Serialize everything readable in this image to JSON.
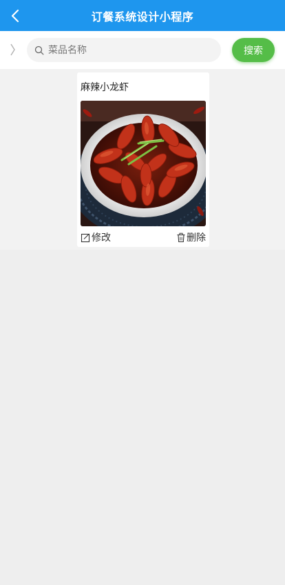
{
  "header": {
    "title": "订餐系统设计小程序",
    "background": "#1e96ee",
    "back_icon": "chevron-left-icon"
  },
  "search": {
    "placeholder": "菜品名称",
    "value": "",
    "button_label": "搜索",
    "button_color": "#55bd48",
    "expand_icon": "chevron-right-icon",
    "search_icon": "magnifier-icon"
  },
  "dishes": [
    {
      "name": "麻辣小龙虾",
      "image": "spicy-crayfish-photo",
      "edit_label": "修改",
      "edit_icon": "edit-icon",
      "delete_label": "删除",
      "delete_icon": "trash-icon"
    }
  ]
}
